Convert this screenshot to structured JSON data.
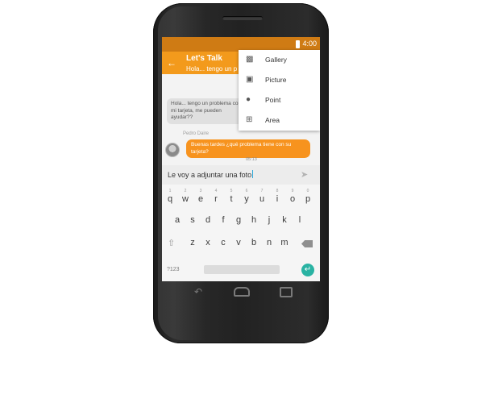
{
  "status_bar": {
    "time": "4:00"
  },
  "chat": {
    "title": "Let's Talk",
    "subtitle": "Hola... tengo un p",
    "messages": [
      {
        "direction": "incoming",
        "text": "Hola... tengo un problema con mi tarjeta, me pueden ayudar??"
      },
      {
        "direction": "outgoing",
        "sender": "Pedro Daire",
        "text": "Buenas tardes ¿qué problema tiene con su tarjeta?",
        "time": "05:13"
      }
    ]
  },
  "compose": {
    "text": "Le voy a adjuntar una foto"
  },
  "attach_menu": {
    "items": [
      {
        "label": "Gallery",
        "icon": "gallery-icon"
      },
      {
        "label": "Picture",
        "icon": "camera-icon"
      },
      {
        "label": "Point",
        "icon": "location-pin-icon"
      },
      {
        "label": "Area",
        "icon": "crop-area-icon"
      }
    ]
  },
  "keyboard": {
    "row1": [
      "q",
      "w",
      "e",
      "r",
      "t",
      "y",
      "u",
      "i",
      "o",
      "p"
    ],
    "row1_hints": [
      "1",
      "2",
      "3",
      "4",
      "5",
      "6",
      "7",
      "8",
      "9",
      "0"
    ],
    "row2": [
      "a",
      "s",
      "d",
      "f",
      "g",
      "h",
      "j",
      "k",
      "l"
    ],
    "row3": [
      "z",
      "x",
      "c",
      "v",
      "b",
      "n",
      "m"
    ],
    "symbols_key": "?123"
  },
  "colors": {
    "accent": "#f39a1c",
    "status_bar": "#cf7b14",
    "outgoing_bubble": "#f7931e",
    "enter_key": "#2ab3a3"
  }
}
